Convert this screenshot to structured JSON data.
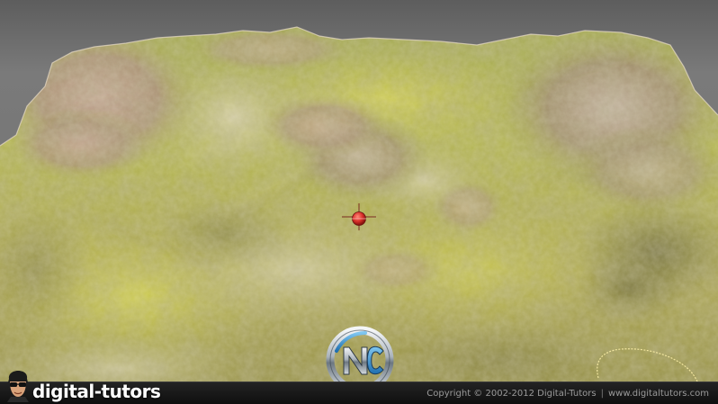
{
  "brand": {
    "name": "digital-tutors"
  },
  "footer": {
    "copyright": "Copyright © 2002-2012 Digital-Tutors",
    "separator": "|",
    "website": "www.digitaltutors.com"
  },
  "watermark": {
    "text": "NC"
  },
  "colors": {
    "terrain_green": "#a9b43a",
    "terrain_tan": "#c8b98c",
    "terrain_rock": "#9a7f6a",
    "marker_red": "#d9302a",
    "footer_bg": "#161616"
  }
}
